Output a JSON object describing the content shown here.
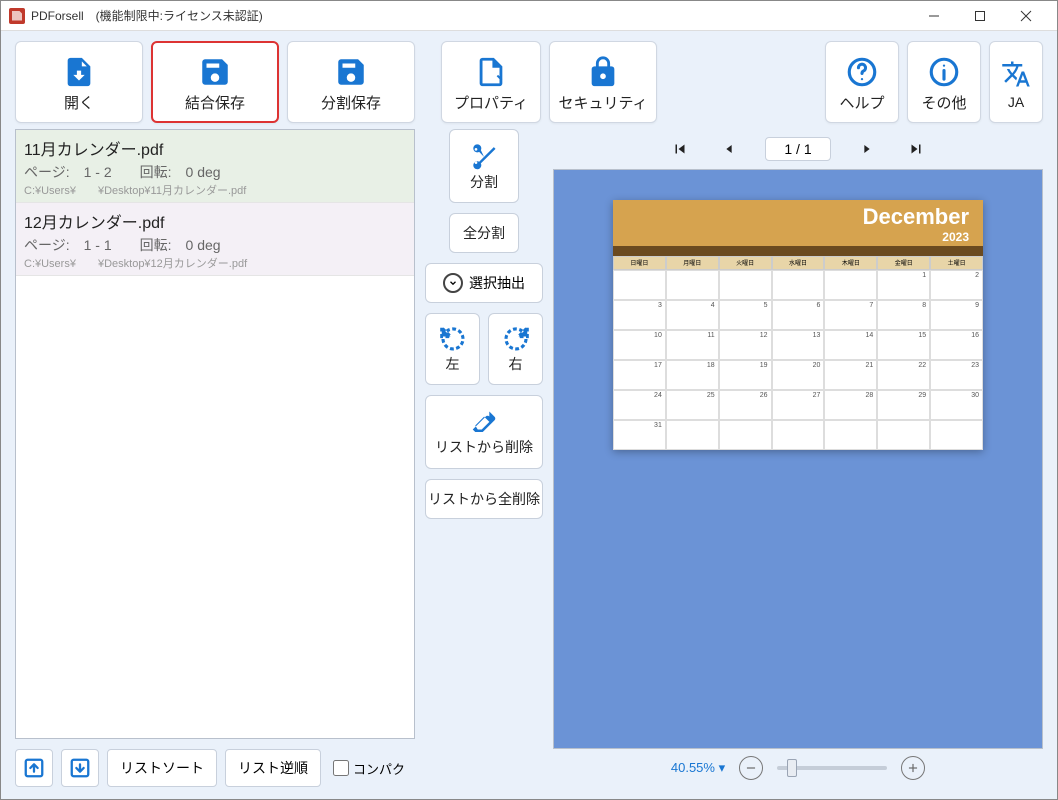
{
  "window": {
    "title": "PDForsell　(機能制限中:ライセンス未認証)"
  },
  "toolbar": {
    "open": "開く",
    "merge_save": "結合保存",
    "split_save": "分割保存",
    "property": "プロパティ",
    "security": "セキュリティ",
    "help": "ヘルプ",
    "other": "その他",
    "lang": "JA"
  },
  "files": [
    {
      "name": "11月カレンダー.pdf",
      "meta": "ページ:　1 - 2　　回転:　0 deg",
      "path": "C:¥Users¥　　¥Desktop¥11月カレンダー.pdf",
      "selected": true
    },
    {
      "name": "12月カレンダー.pdf",
      "meta": "ページ:　1 - 1　　回転:　0 deg",
      "path": "C:¥Users¥　　¥Desktop¥12月カレンダー.pdf",
      "selected": false
    }
  ],
  "leftctrl": {
    "sort": "リストソート",
    "reverse": "リスト逆順",
    "compact": "コンパク"
  },
  "mid": {
    "split": "分割",
    "split_all": "全分割",
    "select_extract": "選択抽出",
    "rotate_left": "左",
    "rotate_right": "右",
    "remove": "リストから削除",
    "remove_all": "リストから全削除"
  },
  "nav": {
    "page": "1 / 1"
  },
  "preview": {
    "month": "December",
    "year": "2023",
    "days": [
      "日曜日",
      "月曜日",
      "火曜日",
      "水曜日",
      "木曜日",
      "金曜日",
      "土曜日"
    ],
    "cells": [
      "",
      "",
      "",
      "",
      "",
      "1",
      "2",
      "3",
      "4",
      "5",
      "6",
      "7",
      "8",
      "9",
      "10",
      "11",
      "12",
      "13",
      "14",
      "15",
      "16",
      "17",
      "18",
      "19",
      "20",
      "21",
      "22",
      "23",
      "24",
      "25",
      "26",
      "27",
      "28",
      "29",
      "30",
      "31",
      "",
      "",
      "",
      "",
      "",
      ""
    ]
  },
  "zoom": {
    "value": "40.55% ▾"
  }
}
